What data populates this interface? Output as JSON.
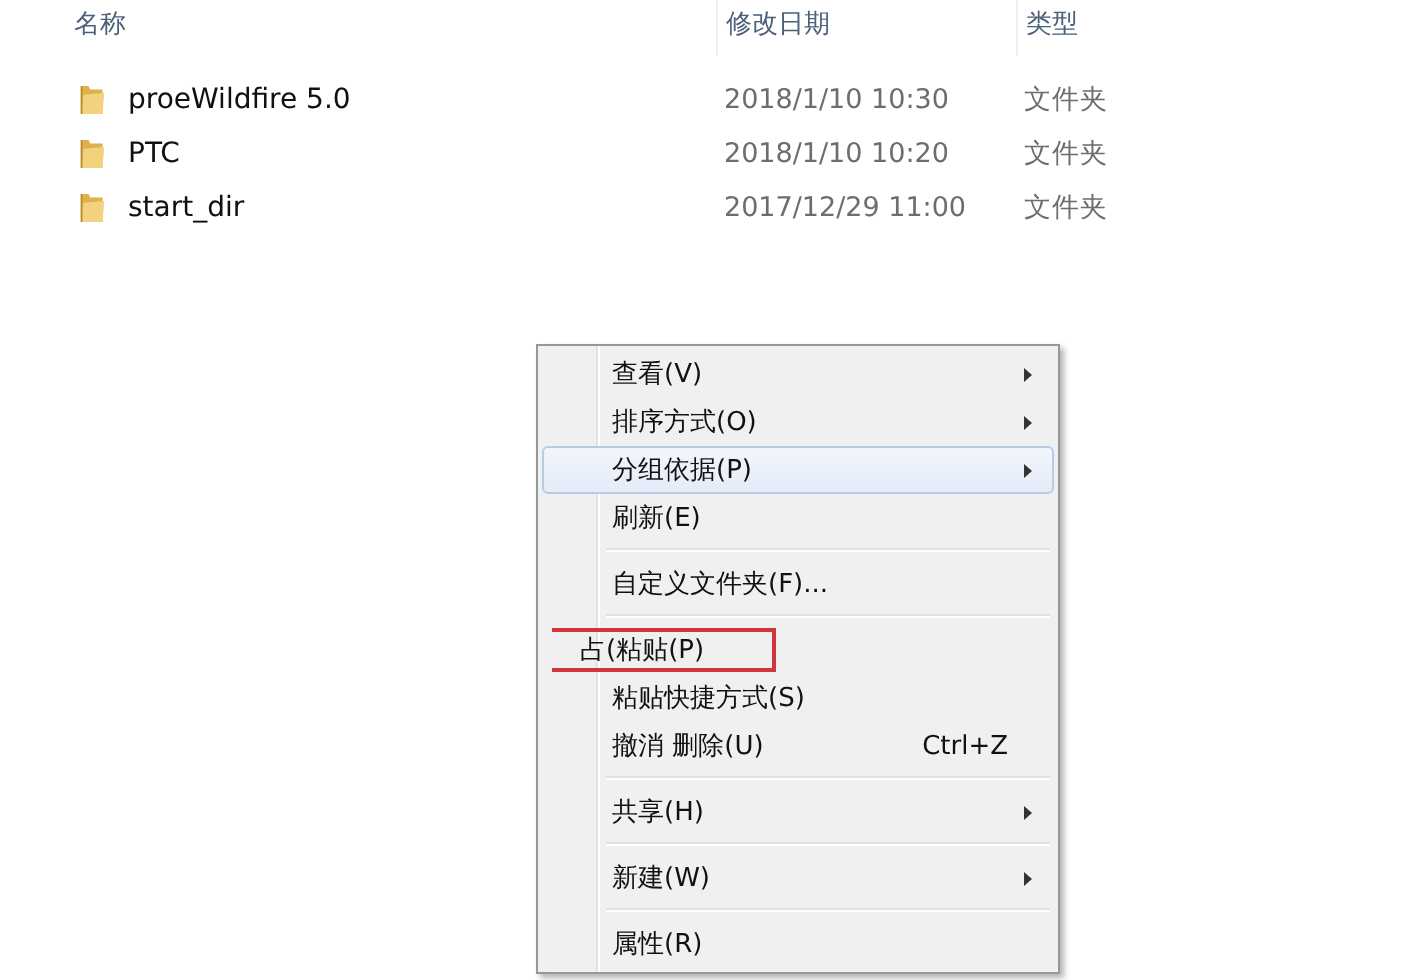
{
  "columns": [
    {
      "label": "名称",
      "kind": "name"
    },
    {
      "label": "修改日期",
      "kind": "date"
    },
    {
      "label": "类型",
      "kind": "type"
    }
  ],
  "files": [
    {
      "name": "proeWildfire 5.0",
      "modified": "2018/1/10 10:30",
      "type": "文件夹"
    },
    {
      "name": "PTC",
      "modified": "2018/1/10 10:20",
      "type": "文件夹"
    },
    {
      "name": "start_dir",
      "modified": "2017/12/29 11:00",
      "type": "文件夹"
    }
  ],
  "context_menu": [
    {
      "kind": "item",
      "label": "查看(V)",
      "submenu": true,
      "selected": false,
      "annotated": false
    },
    {
      "kind": "item",
      "label": "排序方式(O)",
      "submenu": true,
      "selected": false,
      "annotated": false
    },
    {
      "kind": "item",
      "label": "分组依据(P)",
      "submenu": true,
      "selected": true,
      "annotated": false
    },
    {
      "kind": "item",
      "label": "刷新(E)",
      "submenu": false,
      "selected": false,
      "annotated": false
    },
    {
      "kind": "separator"
    },
    {
      "kind": "item",
      "label": "自定义文件夹(F)...",
      "submenu": false,
      "selected": false,
      "annotated": false
    },
    {
      "kind": "separator"
    },
    {
      "kind": "item",
      "label": "占(粘贴(P)",
      "submenu": false,
      "selected": false,
      "annotated": true
    },
    {
      "kind": "item",
      "label": "粘贴快捷方式(S)",
      "submenu": false,
      "selected": false,
      "annotated": false
    },
    {
      "kind": "item",
      "label": "撤消 删除(U)",
      "shortcut": "Ctrl+Z",
      "submenu": false,
      "selected": false,
      "annotated": false
    },
    {
      "kind": "separator"
    },
    {
      "kind": "item",
      "label": "共享(H)",
      "submenu": true,
      "selected": false,
      "annotated": false
    },
    {
      "kind": "separator"
    },
    {
      "kind": "item",
      "label": "新建(W)",
      "submenu": true,
      "selected": false,
      "annotated": false
    },
    {
      "kind": "separator"
    },
    {
      "kind": "item",
      "label": "属性(R)",
      "submenu": false,
      "selected": false,
      "annotated": false
    }
  ]
}
